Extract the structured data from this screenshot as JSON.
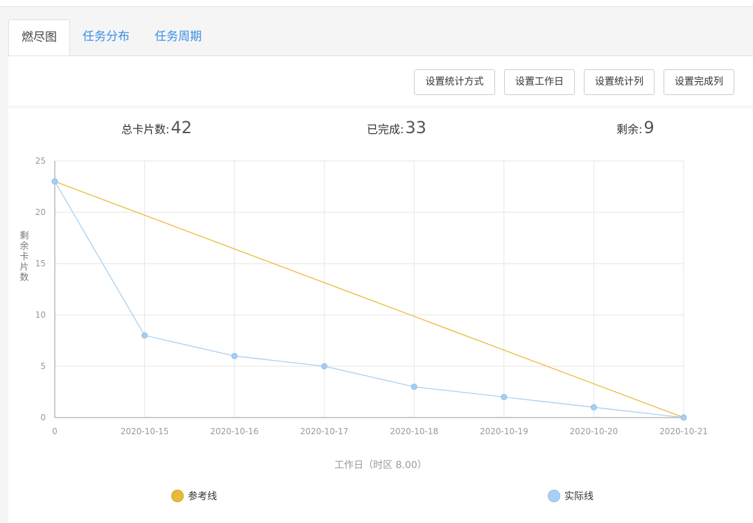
{
  "tabs": [
    {
      "label": "燃尽图",
      "active": true
    },
    {
      "label": "任务分布",
      "active": false
    },
    {
      "label": "任务周期",
      "active": false
    }
  ],
  "toolbar": {
    "set_stat_method": "设置统计方式",
    "set_workdays": "设置工作日",
    "set_stat_columns": "设置统计列",
    "set_done_columns": "设置完成列"
  },
  "stats": {
    "total_label": "总卡片数:",
    "total_value": "42",
    "done_label": "已完成:",
    "done_value": "33",
    "remaining_label": "剩余:",
    "remaining_value": "9"
  },
  "colors": {
    "reference": "#e8b93a",
    "actual": "#a9d0f2",
    "actual_marker": "#a7cff1",
    "tab_link": "#3a8ee6"
  },
  "chart_data": {
    "type": "line",
    "categories": [
      "0",
      "2020-10-15",
      "2020-10-16",
      "2020-10-17",
      "2020-10-18",
      "2020-10-19",
      "2020-10-20",
      "2020-10-21"
    ],
    "series": [
      {
        "name": "参考线",
        "values": [
          23,
          19.71,
          16.43,
          13.14,
          9.86,
          6.57,
          3.29,
          0
        ],
        "markers": false
      },
      {
        "name": "实际线",
        "values": [
          23,
          8,
          6,
          5,
          3,
          2,
          1,
          0
        ],
        "markers": true
      }
    ],
    "xlabel": "工作日（时区 8.00）",
    "ylabel": "剩余卡片数",
    "ylim": [
      0,
      25
    ],
    "yticks": [
      0,
      5,
      10,
      15,
      20,
      25
    ],
    "grid": true,
    "legend_position": "bottom"
  }
}
